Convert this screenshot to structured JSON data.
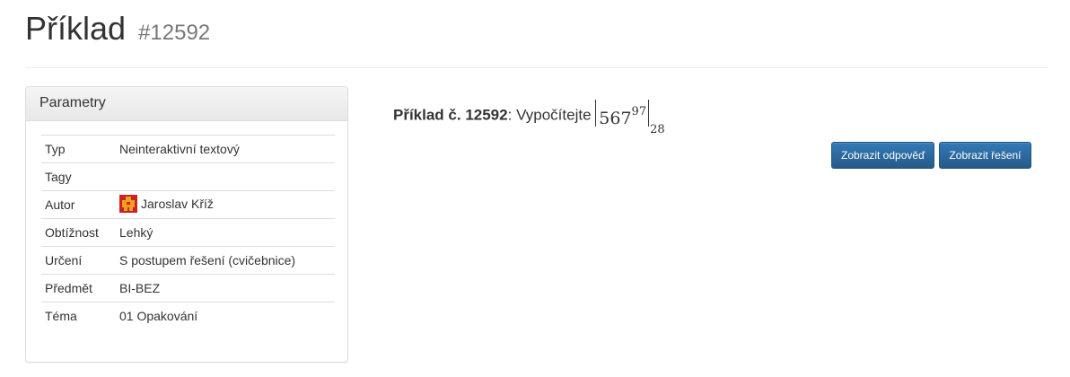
{
  "header": {
    "title": "Příklad",
    "id": "#12592"
  },
  "parameters": {
    "heading": "Parametry",
    "rows": [
      {
        "key": "Typ",
        "value": "Neinteraktivní textový"
      },
      {
        "key": "Tagy",
        "value": ""
      },
      {
        "key": "Autor",
        "value": "Jaroslav Kříž",
        "avatar": "author-avatar"
      },
      {
        "key": "Obtížnost",
        "value": "Lehký"
      },
      {
        "key": "Určení",
        "value": "S postupem řešení (cvičebnice)"
      },
      {
        "key": "Předmět",
        "value": "BI-BEZ"
      },
      {
        "key": "Téma",
        "value": "01 Opakování"
      }
    ]
  },
  "problem": {
    "label": "Příklad č. 12592",
    "separator": ":",
    "text": "Vypočítejte",
    "base": "567",
    "exponent": "97",
    "modulus": "28"
  },
  "buttons": {
    "show_answer": "Zobrazit odpověď",
    "show_solution": "Zobrazit řešení"
  },
  "colors": {
    "button_primary": "#337ab7",
    "avatar_red": "#cc2222",
    "avatar_orange": "#f0a020"
  }
}
